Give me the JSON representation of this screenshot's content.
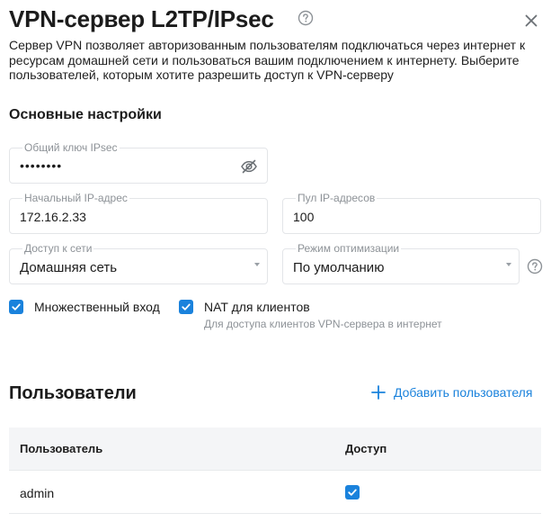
{
  "header": {
    "title": "VPN-сервер L2TP/IPsec",
    "help_icon": "help-circle-icon",
    "close_icon": "close-icon"
  },
  "description": "Сервер VPN позволяет авторизованным пользователям подключаться через интернет к ресурсам домашней сети и пользоваться вашим подключением к интернету. Выберите пользователей, которым хотите разрешить доступ к VPN-серверу",
  "basic": {
    "title": "Основные настройки",
    "psk": {
      "label": "Общий ключ IPsec",
      "value": "••••••••",
      "toggle_icon": "eye-off-icon"
    },
    "start_ip": {
      "label": "Начальный IP-адрес",
      "value": "172.16.2.33"
    },
    "pool": {
      "label": "Пул IP-адресов",
      "value": "100"
    },
    "network_access": {
      "label": "Доступ к сети",
      "value": "Домашняя сеть"
    },
    "optimization": {
      "label": "Режим оптимизации",
      "value": "По умолчанию"
    },
    "multi_login": {
      "label": "Множественный вход",
      "checked": true
    },
    "nat": {
      "label": "NAT для клиентов",
      "checked": true,
      "hint": "Для доступа клиентов VPN-сервера в интернет"
    }
  },
  "users": {
    "title": "Пользователи",
    "add_label": "Добавить пользователя",
    "columns": [
      "Пользователь",
      "Доступ"
    ],
    "rows": [
      {
        "name": "admin",
        "access": true
      }
    ]
  },
  "colors": {
    "accent": "#1a82dc",
    "muted_text": "#8d9297",
    "border": "#e3e5e8",
    "header_bg": "#f4f5f7"
  }
}
